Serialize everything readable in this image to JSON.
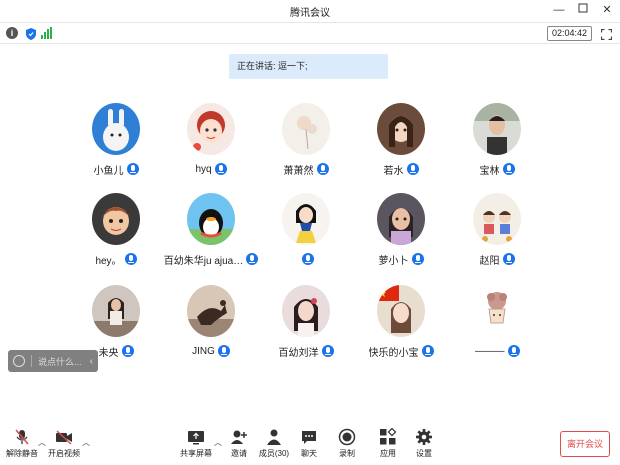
{
  "window": {
    "title": "腾讯会议",
    "minimize_icon": "minimize-icon",
    "maximize_icon": "maximize-icon",
    "close_icon": "close-icon"
  },
  "infobar": {
    "timer": "02:04:42"
  },
  "speaking": {
    "text": "正在讲话: 逗一下;"
  },
  "participants": [
    {
      "name": "小鱼儿",
      "mic_color": "#1a73e8"
    },
    {
      "name": "hyq",
      "mic_color": "#1a73e8"
    },
    {
      "name": "萧萧然",
      "mic_color": "#1a73e8"
    },
    {
      "name": "若水",
      "mic_color": "#1a73e8"
    },
    {
      "name": "宝林",
      "mic_color": "#1a73e8"
    },
    {
      "name": "hey。",
      "mic_color": "#1a73e8"
    },
    {
      "name": "百幼朱华ju ajua…",
      "mic_color": "#1a73e8"
    },
    {
      "name": "",
      "mic_color": "#1a73e8"
    },
    {
      "name": "萝小卜",
      "mic_color": "#1a73e8"
    },
    {
      "name": "赵阳",
      "mic_color": "#1a73e8"
    },
    {
      "name": "未央",
      "mic_color": "#1a73e8"
    },
    {
      "name": "JING",
      "mic_color": "#1a73e8"
    },
    {
      "name": "百幼刘洋",
      "mic_color": "#1a73e8"
    },
    {
      "name": "快乐的小宝",
      "mic_color": "#1a73e8"
    },
    {
      "name": "———",
      "mic_color": "#1a73e8"
    }
  ],
  "chat": {
    "placeholder": "说点什么..."
  },
  "toolbar": {
    "mute_label": "解除静音",
    "video_label": "开启视频",
    "share_label": "共享屏幕",
    "invite_label": "邀请",
    "members_label": "成员(30)",
    "chat_label": "聊天",
    "record_label": "录制",
    "apps_label": "应用",
    "settings_label": "设置",
    "leave_label": "离开会议"
  },
  "colors": {
    "accent": "#1a73e8",
    "speaking_bg": "#dcebfb",
    "leave": "#e24c4c",
    "signal": "#2ab14a"
  }
}
